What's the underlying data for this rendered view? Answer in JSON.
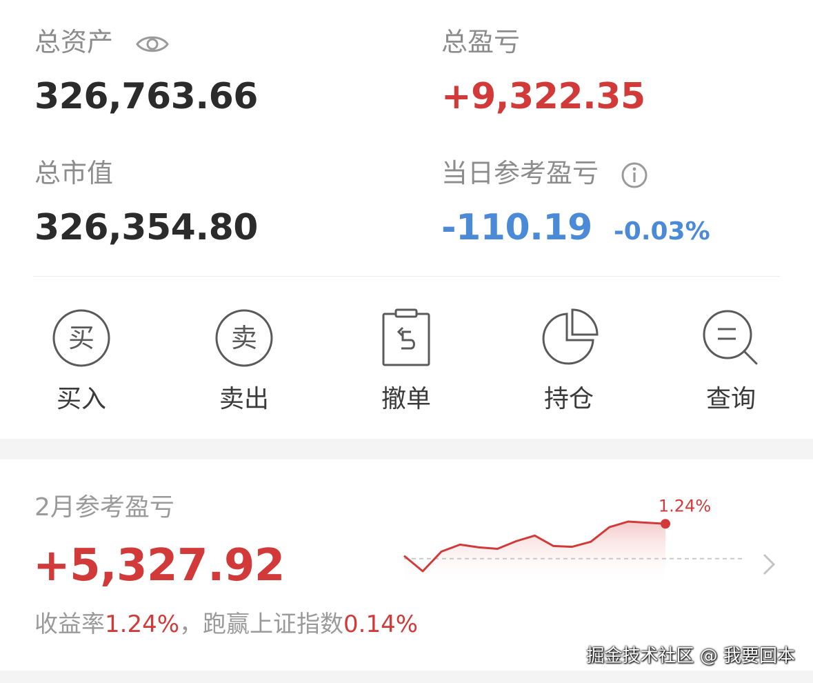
{
  "summary": {
    "total_assets_label": "总资产",
    "total_assets_value": "326,763.66",
    "total_pnl_label": "总盈亏",
    "total_pnl_value": "+9,322.35",
    "market_value_label": "总市值",
    "market_value_value": "326,354.80",
    "daily_pnl_label": "当日参考盈亏",
    "daily_pnl_value": "-110.19",
    "daily_pnl_pct": "-0.03%"
  },
  "actions": [
    {
      "label": "买入",
      "glyph": "买",
      "icon": "buy-icon"
    },
    {
      "label": "卖出",
      "glyph": "卖",
      "icon": "sell-icon"
    },
    {
      "label": "撤单",
      "icon": "cancel-order-icon"
    },
    {
      "label": "持仓",
      "icon": "pie-chart-icon"
    },
    {
      "label": "查询",
      "icon": "search-icon"
    }
  ],
  "monthly": {
    "label": "2月参考盈亏",
    "value": "+5,327.92",
    "yield_label": "收益率",
    "yield_value": "1.24%",
    "separator": "，",
    "beat_label": "跑赢上证指数",
    "beat_value": "0.14%",
    "chart_end_label": "1.24%"
  },
  "chart_data": {
    "type": "area",
    "values": [
      0.1,
      -0.45,
      0.25,
      0.5,
      0.4,
      0.35,
      0.62,
      0.82,
      0.45,
      0.42,
      0.6,
      1.12,
      1.32,
      1.28,
      1.24
    ],
    "baseline": 0,
    "end_label": "1.24%"
  },
  "colors": {
    "up": "#d23a3a",
    "down": "#4a8ad6",
    "label": "#8c8c8c",
    "text": "#2b2b2b"
  },
  "watermark": "掘金技术社区 @ 我要回本"
}
